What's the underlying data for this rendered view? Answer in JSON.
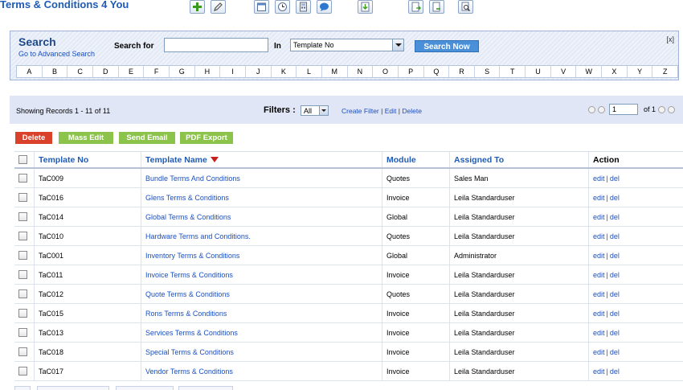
{
  "header": {
    "title": "Terms & Conditions 4 You"
  },
  "toolbar": {
    "icons": [
      "add-icon",
      "edit-icon",
      "calendar-icon",
      "clock-icon",
      "calculator-icon",
      "chat-icon",
      "import-icon",
      "export-icon",
      "export-alt-icon",
      "find-duplicates-icon"
    ]
  },
  "search": {
    "title": "Search",
    "advanced_link": "Go to Advanced Search",
    "search_for_label": "Search for",
    "search_value": "",
    "in_label": "In",
    "field_value": "Template No",
    "button_label": "Search Now",
    "close_label": "[x]",
    "alphabet": [
      "A",
      "B",
      "C",
      "D",
      "E",
      "F",
      "G",
      "H",
      "I",
      "J",
      "K",
      "L",
      "M",
      "N",
      "O",
      "P",
      "Q",
      "R",
      "S",
      "T",
      "U",
      "V",
      "W",
      "X",
      "Y",
      "Z"
    ]
  },
  "listview": {
    "records_text": "Showing Records 1 - 11 of 11",
    "filters_label": "Filters :",
    "filter_value": "All",
    "create_filter": "Create Filter",
    "edit_filter": "Edit",
    "delete_filter": "Delete",
    "sep": "|",
    "page_value": "1",
    "page_of": "of 1"
  },
  "actions": {
    "delete": "Delete",
    "mass_edit": "Mass Edit",
    "send_email": "Send Email",
    "pdf_export": "PDF Export"
  },
  "table": {
    "columns": {
      "template_no": "Template No",
      "template_name": "Template Name",
      "module": "Module",
      "assigned_to": "Assigned To",
      "action": "Action"
    },
    "rows": [
      {
        "no": "TaC009",
        "name": "Bundle Terms And Conditions",
        "module": "Quotes",
        "assigned": "Sales Man",
        "edit": "edit",
        "del": "del"
      },
      {
        "no": "TaC016",
        "name": "Glens Terms & Conditions",
        "module": "Invoice",
        "assigned": "Leila Standarduser",
        "edit": "edit",
        "del": "del"
      },
      {
        "no": "TaC014",
        "name": "Global Terms & Conditions",
        "module": "Global",
        "assigned": "Leila Standarduser",
        "edit": "edit",
        "del": "del"
      },
      {
        "no": "TaC010",
        "name": "Hardware Terms and Conditions.",
        "module": "Quotes",
        "assigned": "Leila Standarduser",
        "edit": "edit",
        "del": "del"
      },
      {
        "no": "TaC001",
        "name": "Inventory Terms & Conditions",
        "module": "Global",
        "assigned": "Administrator",
        "edit": "edit",
        "del": "del"
      },
      {
        "no": "TaC011",
        "name": "Invoice Terms & Conditions",
        "module": "Invoice",
        "assigned": "Leila Standarduser",
        "edit": "edit",
        "del": "del"
      },
      {
        "no": "TaC012",
        "name": "Quote Terms & Conditions",
        "module": "Quotes",
        "assigned": "Leila Standarduser",
        "edit": "edit",
        "del": "del"
      },
      {
        "no": "TaC015",
        "name": "Rons Terms & Conditions",
        "module": "Invoice",
        "assigned": "Leila Standarduser",
        "edit": "edit",
        "del": "del"
      },
      {
        "no": "TaC013",
        "name": "Services Terms & Conditions",
        "module": "Invoice",
        "assigned": "Leila Standarduser",
        "edit": "edit",
        "del": "del"
      },
      {
        "no": "TaC018",
        "name": "Special Terms & Conditions",
        "module": "Invoice",
        "assigned": "Leila Standarduser",
        "edit": "edit",
        "del": "del"
      },
      {
        "no": "TaC017",
        "name": "Vendor Terms & Conditions",
        "module": "Invoice",
        "assigned": "Leila Standarduser",
        "edit": "edit",
        "del": "del"
      }
    ]
  },
  "colors": {
    "title_blue": "#1f5bb5",
    "link_blue": "#1a4fbf",
    "delete_red": "#d9412b",
    "action_green": "#8cc34a",
    "search_blue": "#4a90d9",
    "filter_bar": "#e1e6f7"
  }
}
